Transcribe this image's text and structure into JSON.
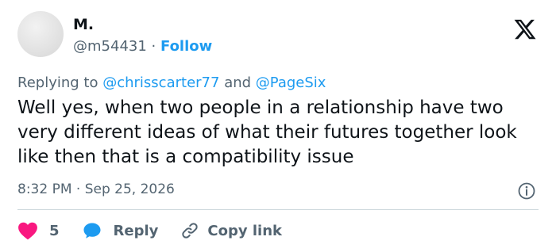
{
  "author": {
    "name": "M.",
    "handle": "@m54431",
    "separator": "·",
    "follow_label": "Follow"
  },
  "reply_context": {
    "prefix": "Replying to",
    "mention_1": "@chrisscarter77",
    "conjunction": "and",
    "mention_2": "@PageSix"
  },
  "tweet": {
    "text": "Well yes, when two people in a relationship have two very different ideas of what their futures together look like then that is a compatibility issue",
    "time": "8:32 PM",
    "separator": "·",
    "date": "Sep 25, 2026"
  },
  "actions": {
    "like_count": "5",
    "reply_label": "Reply",
    "copy_link_label": "Copy link"
  },
  "icons": {
    "logo": "x-logo-icon",
    "info": "info-icon",
    "like": "heart-icon",
    "reply": "chat-bubble-icon",
    "copy": "link-icon"
  },
  "colors": {
    "accent": "#1d9bf0",
    "like": "#f91880",
    "muted": "#536471",
    "text": "#0f1419",
    "divider": "#cfd9de"
  }
}
